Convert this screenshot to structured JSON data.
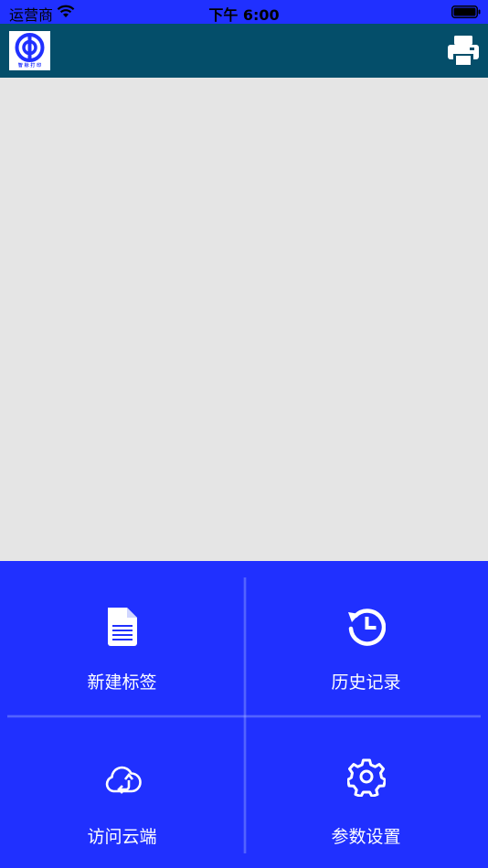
{
  "status_bar": {
    "carrier": "运营商",
    "time": "下午 6:00",
    "wifi_icon": "wifi-icon",
    "battery_icon": "battery-icon"
  },
  "header": {
    "logo_text": "智 标 打 印",
    "print_icon": "printer-icon",
    "background": "#044e6a"
  },
  "colors": {
    "accent": "#2030ff",
    "canvas": "#e5e5e5"
  },
  "menu": {
    "items": [
      {
        "label": "新建标签",
        "icon": "document-icon"
      },
      {
        "label": "历史记录",
        "icon": "history-icon"
      },
      {
        "label": "访问云端",
        "icon": "cloud-icon"
      },
      {
        "label": "参数设置",
        "icon": "gear-icon"
      }
    ]
  }
}
